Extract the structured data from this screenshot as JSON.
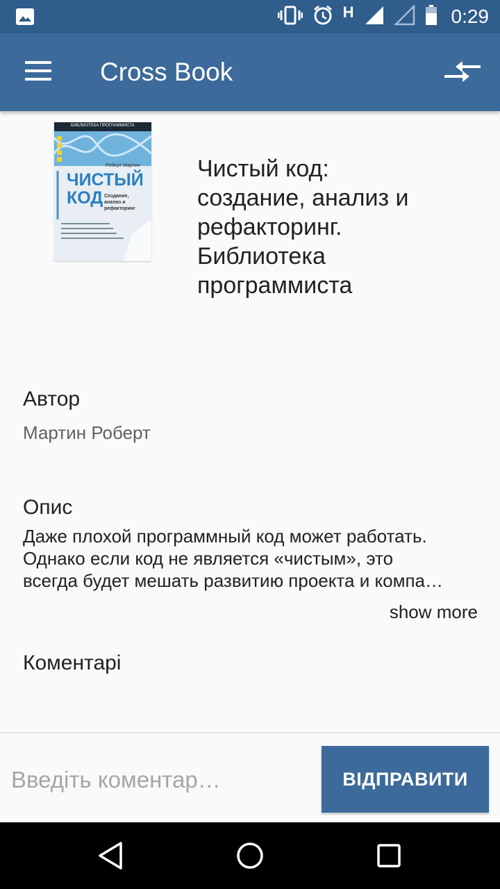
{
  "status_bar": {
    "network_letter": "H",
    "time": "0:29",
    "icons": [
      "image-notification-icon",
      "vibrate-icon",
      "alarm-icon",
      "signal-icon",
      "signal-empty-icon",
      "battery-icon"
    ]
  },
  "app_bar": {
    "title": "Cross Book",
    "left_icon": "menu-icon",
    "right_icon": "swap-icon"
  },
  "book": {
    "cover": {
      "series": "БИБЛИОТЕКА ПРОГРАММИСТА",
      "author": "Роберт Мартин",
      "title_line1": "ЧИСТЫЙ",
      "title_line2": "КОД",
      "subtitle": "Создание, анализ и рефакторинг"
    },
    "title": "Чистый код: создание, анализ и рефакторинг. Библиотека программиста"
  },
  "author": {
    "label": "Автор",
    "value": "Мартин Роберт"
  },
  "description": {
    "label": "Опис",
    "lines": [
      "Даже плохой программный код может работать.",
      "Однако если код не является «чистым», это",
      "всегда будет мешать развитию проекта и компа…"
    ],
    "show_more": "show more"
  },
  "comments": {
    "label": "Коментарі",
    "input_placeholder": "Введіть коментар…",
    "send_label": "ВІДПРАВИТИ"
  },
  "colors": {
    "status_bar": "#2f5d8c",
    "app_bar": "#3c6a9a",
    "background": "#fafafa"
  }
}
